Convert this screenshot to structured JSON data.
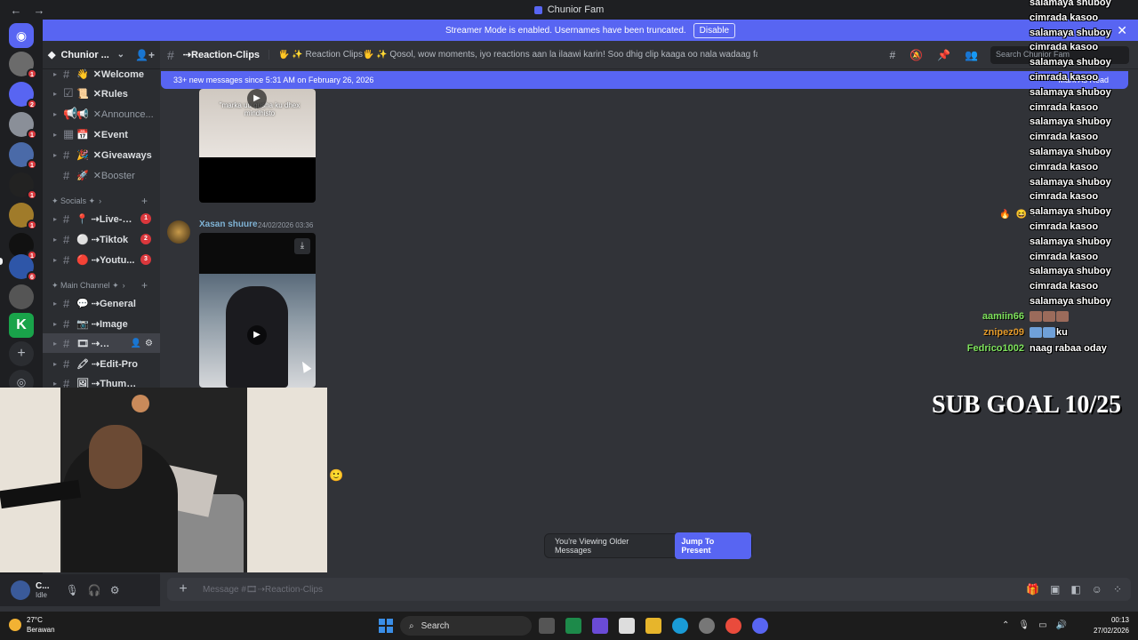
{
  "window": {
    "title": "Chunior Fam",
    "back": "←",
    "forward": "→"
  },
  "banner": {
    "text": "Streamer Mode is enabled. Usernames have been truncated.",
    "button": "Disable",
    "close": "✕"
  },
  "rail": {
    "badges": [
      "1",
      "2",
      "1",
      "1",
      "1",
      "1",
      "1",
      "1",
      "6"
    ],
    "home_icon": "discord-icon"
  },
  "server": {
    "name": "Chunior ...",
    "chevron": "⌄",
    "invite_icon": "👤+"
  },
  "channels": [
    {
      "prefix": "👋",
      "name": "✕Welcome",
      "count": ""
    },
    {
      "prefix": "📜",
      "name": "✕Rules",
      "count": ""
    },
    {
      "prefix": "📢",
      "name": "✕Announce...",
      "count": ""
    },
    {
      "prefix": "📅",
      "name": "✕Event",
      "count": ""
    },
    {
      "prefix": "🎉",
      "name": "✕Giveaways",
      "count": ""
    },
    {
      "prefix": "🚀",
      "name": "✕Booster",
      "count": ""
    }
  ],
  "category_socials": "✦ Socials ✦",
  "socials": [
    {
      "name": "📍 ⇢Live-S...",
      "count": "1"
    },
    {
      "name": "⚪ ⇢Tiktok",
      "count": "2"
    },
    {
      "name": "🔴 ⇢Youtu...",
      "count": "3"
    }
  ],
  "category_main": "✦ Main Channel ✦",
  "main_channels": [
    {
      "name": "💬 ⇢General"
    },
    {
      "name": "📷 ⇢Image"
    },
    {
      "name": "🎞 ⇢Reac..."
    },
    {
      "name": "🖍 ⇢Edit-Pro"
    },
    {
      "name": "🖼 ⇢Thumbnail"
    }
  ],
  "header": {
    "channel": "⇢Reaction-Clips",
    "topic": "🖐 ✨ Reaction Clips🖐 ✨ Qosol, wow moments, iyo reactions aan la ilaawi karin! Soo dhig clip kaaga oo nala wadaag falcelintaada😆",
    "search_placeholder": "Search Chunior Fam"
  },
  "new_messages": {
    "text": "33+ new messages since 5:31 AM on February 26, 2026",
    "mark": "Mark As Read"
  },
  "messages": [
    {
      "caption": "\"marka uu qusha ku dhex mindhisto"
    },
    {
      "author": "Xasan shuure",
      "time": "24/02/2026 03:36"
    }
  ],
  "overlay_chat": [
    "salamaya shuboy",
    "cimrada kasoo",
    "salamaya shuboy",
    "cimrada kasoo",
    "salamaya shuboy",
    "cimrada kasoo",
    "salamaya shuboy",
    "cimrada kasoo",
    "salamaya shuboy",
    "cimrada kasoo",
    "salamaya shuboy",
    "cimrada kasoo",
    "salamaya shuboy",
    "cimrada kasoo",
    "salamaya shuboy",
    "cimrada kasoo",
    "salamaya shuboy",
    "cimrada kasoo",
    "salamaya shuboy",
    "cimrada kasoo",
    "salamaya shuboy"
  ],
  "overlay_users": [
    {
      "user": "aamiin66",
      "msg": "",
      "color": "#7ee35c"
    },
    {
      "user": "znipez09",
      "msg": "ku",
      "color": "#e39a2b"
    },
    {
      "user": "Fedrico1002",
      "msg": "naag rabaa oday",
      "color": "#7ee35c"
    }
  ],
  "sub_goal": "SUB GOAL 10/25",
  "older_pill": {
    "text": "You're Viewing Older Messages",
    "button": "Jump To Present"
  },
  "user_panel": {
    "name": "C...",
    "status": "Idle"
  },
  "composer": {
    "placeholder": "Message #🎞⇢Reaction-Clips"
  },
  "taskbar": {
    "temp": "27°C",
    "weather": "Berawan",
    "search": "Search",
    "time": "00:13",
    "date": "27/02/2026"
  },
  "colors": {
    "blurple": "#5865f2",
    "danger": "#da373c",
    "background": "#313338"
  }
}
